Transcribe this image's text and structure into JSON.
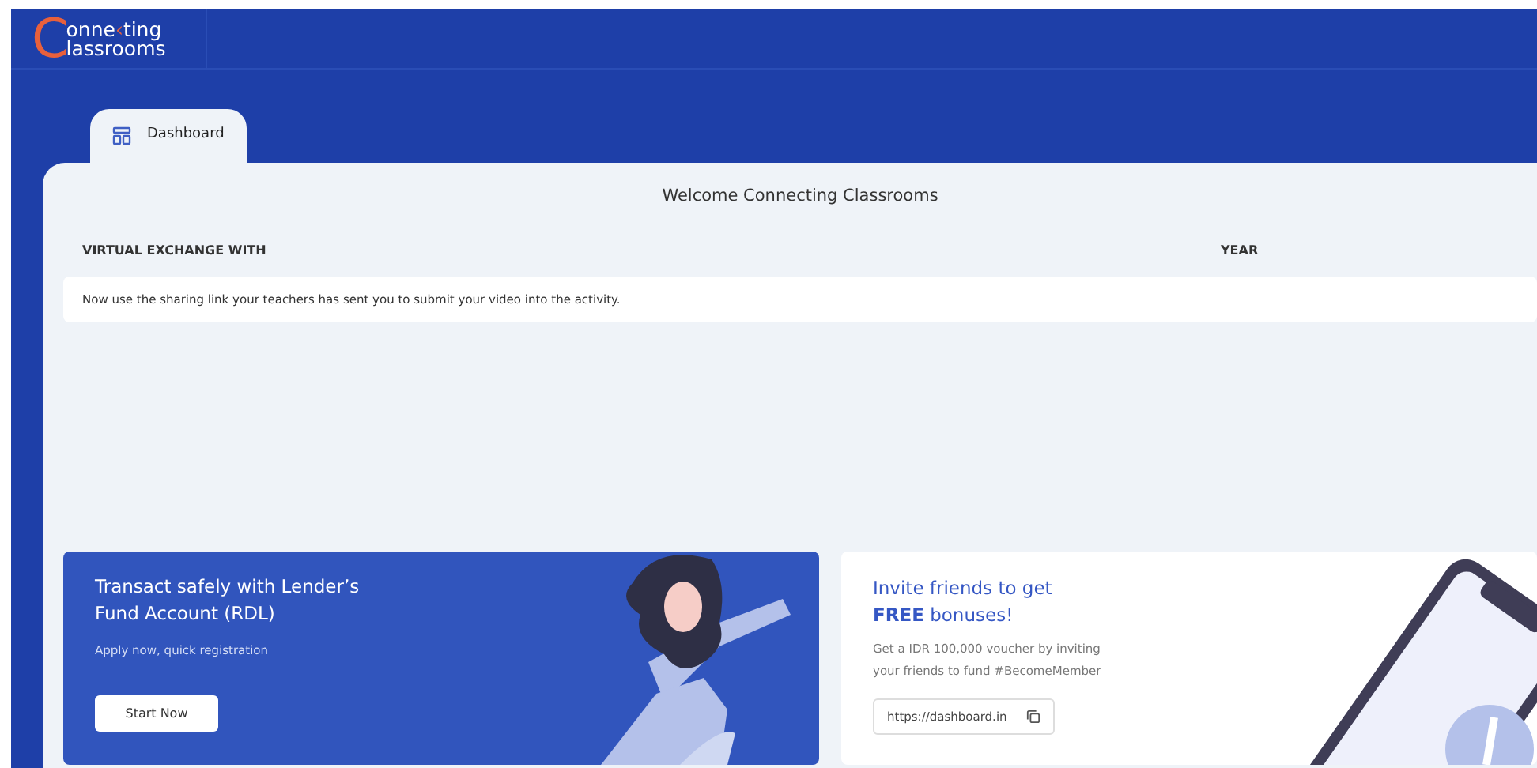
{
  "logo": {
    "initial": "C",
    "line1_start": "onne",
    "line1_mark": "‹",
    "line1_end": "ting",
    "line2": "lassrooms"
  },
  "tabs": [
    {
      "label": "Dashboard",
      "selected": true
    }
  ],
  "welcome": "Welcome Connecting Classrooms",
  "table": {
    "columns": [
      "VIRTUAL EXCHANGE WITH",
      "YEAR"
    ],
    "rows": [
      {
        "message": "Now use the sharing link your teachers has sent you to submit your video into the activity."
      }
    ]
  },
  "promo_card": {
    "title_line1": "Transact safely with Lender’s",
    "title_line2": "Fund Account (RDL)",
    "subtitle": "Apply now, quick registration",
    "button": "Start Now"
  },
  "invite_card": {
    "title_line1": "Invite friends to get",
    "title_line2": "**FREE** bonuses!",
    "text_line1": "Get a IDR 100,000 voucher by inviting",
    "text_line2": "your friends to fund #BecomeMember",
    "link": "https://dashboard.in"
  }
}
